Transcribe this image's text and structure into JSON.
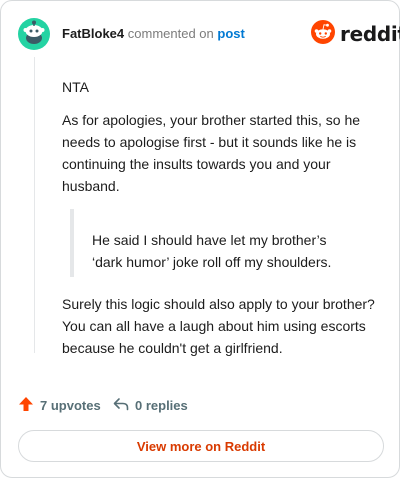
{
  "header": {
    "username": "FatBloke4",
    "commented_on": "commented on",
    "post_link": "post",
    "brand": "reddit"
  },
  "comment": {
    "line1": "NTA",
    "paragraph1": "As for apologies, your brother started this, so he needs to apologise first - but it sounds like he is continuing the insults towards you and your husband.",
    "quote": "He said I should have let my brother’s ‘dark humor’ joke roll off my shoulders.",
    "paragraph2": "Surely this logic should also apply to your brother? You can all have a laugh about him using escorts because he couldn't get a girlfriend."
  },
  "footer": {
    "upvotes": "7 upvotes",
    "replies": "0 replies",
    "view_more": "View more on Reddit"
  },
  "icons": {
    "avatar": "snoo-avatar-icon",
    "logo": "reddit-logo-icon",
    "upvote": "upvote-arrow-icon",
    "reply": "reply-arrow-icon"
  },
  "colors": {
    "brand_orange": "#ff4500",
    "link_blue": "#0079d3",
    "avatar_teal": "#24d3a3",
    "button_text": "#d93a00"
  }
}
